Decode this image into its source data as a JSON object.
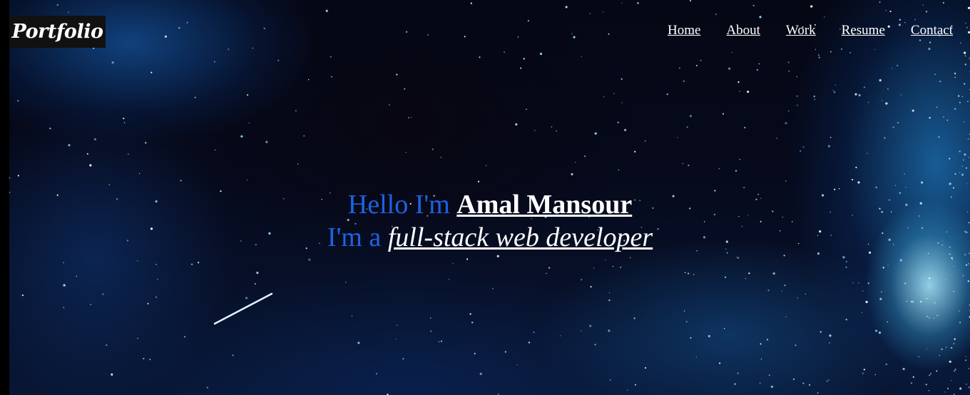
{
  "header": {
    "logo_text": "Portfolio",
    "nav": [
      {
        "label": "Home"
      },
      {
        "label": "About"
      },
      {
        "label": "Work"
      },
      {
        "label": "Resume"
      },
      {
        "label": "Contact"
      }
    ]
  },
  "hero": {
    "greeting": "Hello I'm",
    "name": "Amal Mansour",
    "role_prefix": "I'm a",
    "role": "full-stack web developer"
  },
  "colors": {
    "accent": "#1f62e0",
    "text": "#ffffff",
    "logo_bg": "#111111",
    "page_bg": "#000000"
  },
  "background": {
    "description_icon": "night-sky-image"
  }
}
